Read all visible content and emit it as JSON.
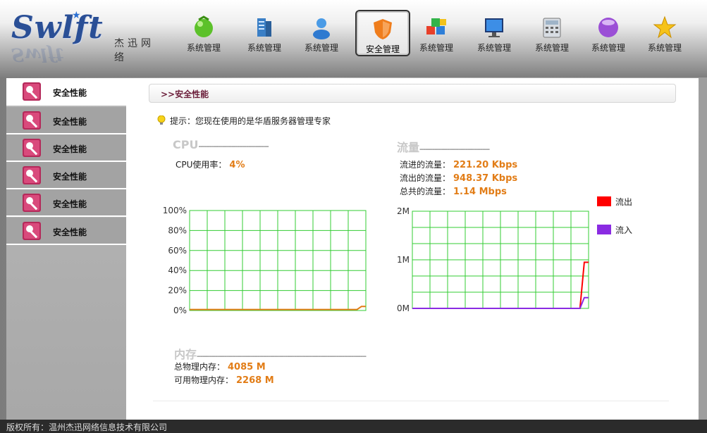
{
  "logo": {
    "brand": "Swlft",
    "brand_cn": "杰迅网络"
  },
  "nav": [
    {
      "label": "系统管理",
      "icon": "green-ball-icon",
      "active": false
    },
    {
      "label": "系统管理",
      "icon": "server-icon",
      "active": false
    },
    {
      "label": "系统管理",
      "icon": "user-icon",
      "active": false
    },
    {
      "label": "安全管理",
      "icon": "shield-icon",
      "active": true
    },
    {
      "label": "系统管理",
      "icon": "cubes-icon",
      "active": false
    },
    {
      "label": "系统管理",
      "icon": "monitor-icon",
      "active": false
    },
    {
      "label": "系统管理",
      "icon": "calculator-icon",
      "active": false
    },
    {
      "label": "系统管理",
      "icon": "purple-ball-icon",
      "active": false
    },
    {
      "label": "系统管理",
      "icon": "star-icon",
      "active": false
    }
  ],
  "sidebar": {
    "items": [
      {
        "label": "安全性能",
        "icon": "key-icon",
        "active": true
      },
      {
        "label": "安全性能",
        "icon": "key-icon",
        "active": false
      },
      {
        "label": "安全性能",
        "icon": "key-icon",
        "active": false
      },
      {
        "label": "安全性能",
        "icon": "key-icon",
        "active": false
      },
      {
        "label": "安全性能",
        "icon": "key-icon",
        "active": false
      },
      {
        "label": "安全性能",
        "icon": "key-icon",
        "active": false
      }
    ]
  },
  "breadcrumb": ">>安全性能",
  "tip": "提示：您现在使用的是华盾服务器管理专家",
  "cpu": {
    "title": "CPU",
    "usage_label": "CPU使用率：",
    "usage_value": "4%"
  },
  "traffic": {
    "title": "流量",
    "in_label": "流进的流量：",
    "in_value": "221.20 Kbps",
    "out_label": "流出的流量：",
    "out_value": "948.37 Kbps",
    "total_label": "总共的流量：",
    "total_value": "1.14 Mbps"
  },
  "memory": {
    "title": "内存",
    "total_label": "总物理内存：",
    "total_value": "4085 M",
    "avail_label": "可用物理内存：",
    "avail_value": "2268 M"
  },
  "legend": [
    {
      "label": "流出",
      "color": "#ff0000"
    },
    {
      "label": "流入",
      "color": "#8a2be2"
    }
  ],
  "colors": {
    "grid": "#33cc33",
    "cpu_line": "#e27d17",
    "value_text": "#e27d17"
  },
  "chart_data": [
    {
      "type": "line",
      "ylim": [
        0,
        100
      ],
      "yticks": [
        "0%",
        "20%",
        "40%",
        "60%",
        "80%",
        "100%"
      ],
      "series": [
        {
          "values": [
            1,
            1,
            1,
            1,
            1,
            1,
            1,
            1,
            1,
            1,
            1,
            1,
            1,
            1,
            1,
            1,
            1,
            1,
            1,
            1,
            1,
            1,
            1,
            1,
            1,
            1,
            1,
            1,
            1,
            1,
            1,
            1,
            1,
            1,
            1,
            1,
            1,
            1,
            1,
            4,
            4
          ]
        }
      ]
    },
    {
      "type": "line",
      "ylim": [
        0,
        2
      ],
      "yticks": [
        "0M",
        "1M",
        "2M"
      ],
      "series": [
        {
          "name": "流出",
          "values": [
            0,
            0,
            0,
            0,
            0,
            0,
            0,
            0,
            0,
            0,
            0,
            0,
            0,
            0,
            0,
            0,
            0,
            0,
            0,
            0,
            0,
            0,
            0,
            0,
            0,
            0,
            0,
            0,
            0,
            0,
            0,
            0,
            0,
            0,
            0,
            0,
            0,
            0,
            0,
            0,
            0.95,
            0.95
          ]
        },
        {
          "name": "流入",
          "values": [
            0,
            0,
            0,
            0,
            0,
            0,
            0,
            0,
            0,
            0,
            0,
            0,
            0,
            0,
            0,
            0,
            0,
            0,
            0,
            0,
            0,
            0,
            0,
            0,
            0,
            0,
            0,
            0,
            0,
            0,
            0,
            0,
            0,
            0,
            0,
            0,
            0,
            0,
            0,
            0,
            0.22,
            0.22
          ]
        }
      ]
    }
  ],
  "footer": "版权所有：温州杰迅网络信息技术有限公司"
}
